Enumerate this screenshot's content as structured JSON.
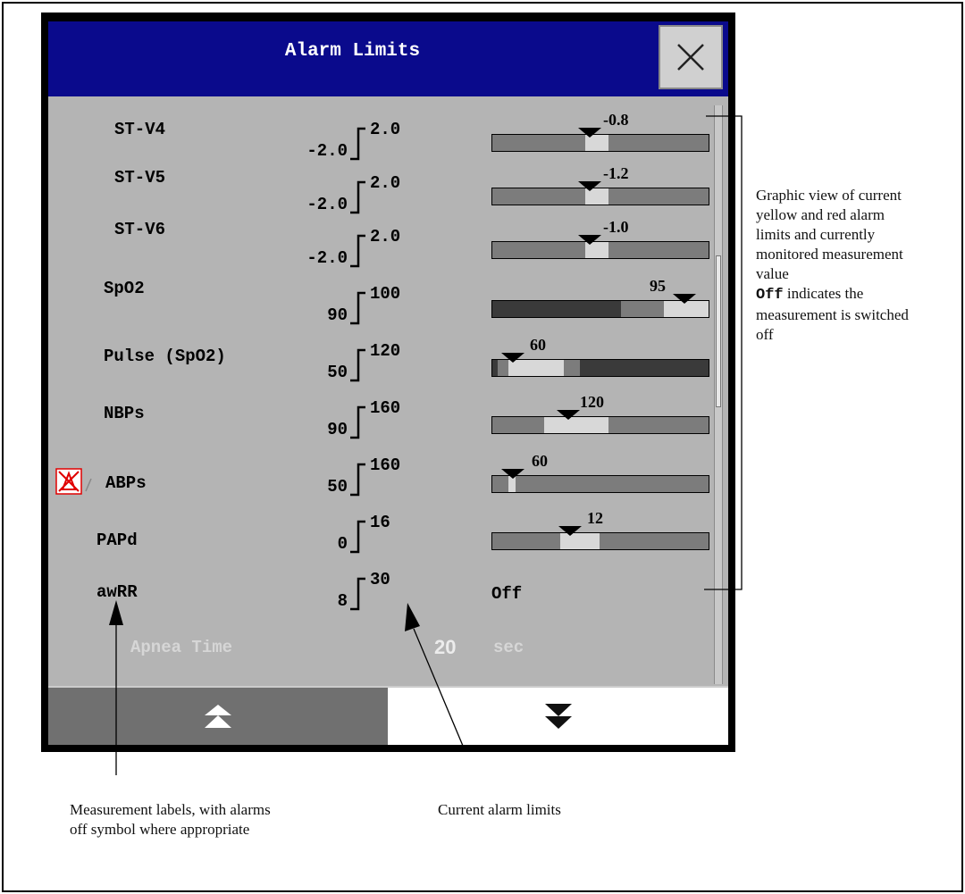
{
  "dialog": {
    "title": "Alarm Limits",
    "close_icon": "close-x-icon"
  },
  "rows": [
    {
      "label": "ST-V4",
      "low": "-2.0",
      "high": "2.0",
      "current": "-0.8"
    },
    {
      "label": "ST-V5",
      "low": "-2.0",
      "high": "2.0",
      "current": "-1.2"
    },
    {
      "label": "ST-V6",
      "low": "-2.0",
      "high": "2.0",
      "current": "-1.0"
    },
    {
      "label": "SpO2",
      "low": "90",
      "high": "100",
      "current": "95"
    },
    {
      "label": "Pulse (SpO2)",
      "low": "50",
      "high": "120",
      "current": "60"
    },
    {
      "label": "NBPs",
      "low": "90",
      "high": "160",
      "current": "120"
    },
    {
      "label": "ABPs",
      "low": "50",
      "high": "160",
      "current": "60",
      "alarms_off_icon": "alarm-off-icon"
    },
    {
      "label": "PAPd",
      "low": "0",
      "high": "16",
      "current": "12"
    },
    {
      "label": "awRR",
      "low": "8",
      "high": "30",
      "status": "Off"
    }
  ],
  "apnea": {
    "label": "Apnea Time",
    "value": "20",
    "unit": "sec"
  },
  "nav": {
    "up_icon": "double-chevron-up-icon",
    "down_icon": "double-chevron-down-icon"
  },
  "annotations": {
    "graphic_view_line1": "Graphic view of current",
    "graphic_view_line2": "yellow and red alarm",
    "graphic_view_line3": "limits and currently",
    "graphic_view_line4": "monitored measurement",
    "graphic_view_line5": "value",
    "off_word": "Off",
    "off_rest": " indicates the",
    "off_line2": "measurement is switched",
    "off_line3": "off",
    "labels_line1": "Measurement labels, with alarms",
    "labels_line2": "off symbol where appropriate",
    "limits_note": "Current alarm limits"
  },
  "colors": {
    "titlebar": "#0a0a8c",
    "panel": "#b4b4b4",
    "bar_dark": "#3a3a3a",
    "bar_mid": "#7c7c7c",
    "bar_light": "#d8d8d8",
    "alarm_off_red": "#e00000"
  }
}
